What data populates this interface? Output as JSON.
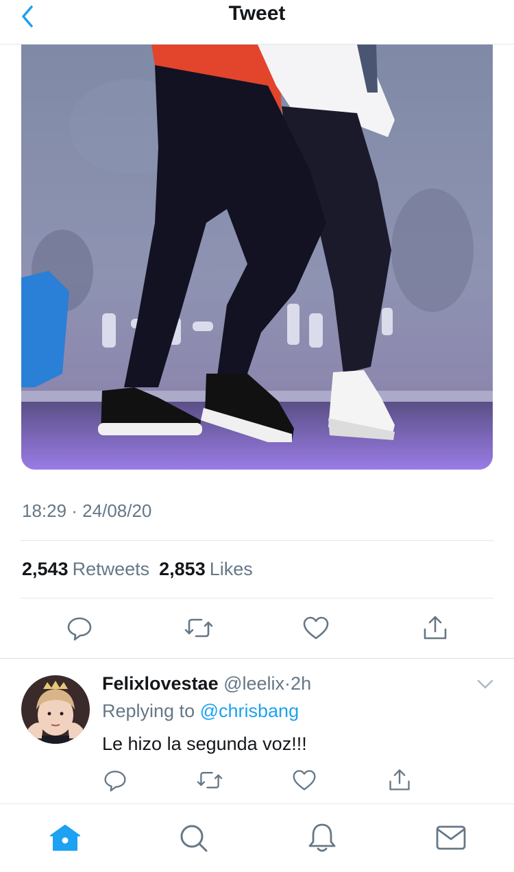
{
  "header": {
    "title": "Tweet"
  },
  "tweet": {
    "timestamp": "18:29 · 24/08/20",
    "retweets_count": "2,543",
    "retweets_label": "Retweets",
    "likes_count": "2,853",
    "likes_label": "Likes"
  },
  "reply": {
    "name": "Felixlovestae",
    "handle": "@leelix",
    "dot": "·",
    "time": "2h",
    "replying_prefix": "Replying to",
    "replying_to": "@chrisbang",
    "text": "Le hizo la segunda voz!!!"
  },
  "icons": {
    "back": "chevron-left-icon",
    "reply": "comment-icon",
    "retweet": "retweet-icon",
    "like": "heart-icon",
    "share": "share-icon",
    "more": "chevron-down-icon",
    "tabs": [
      "home-icon",
      "search-icon",
      "bell-icon",
      "mail-icon"
    ]
  },
  "colors": {
    "accent": "#1da1f2",
    "secondary_text": "#657786",
    "divider": "#e1e8ed"
  }
}
